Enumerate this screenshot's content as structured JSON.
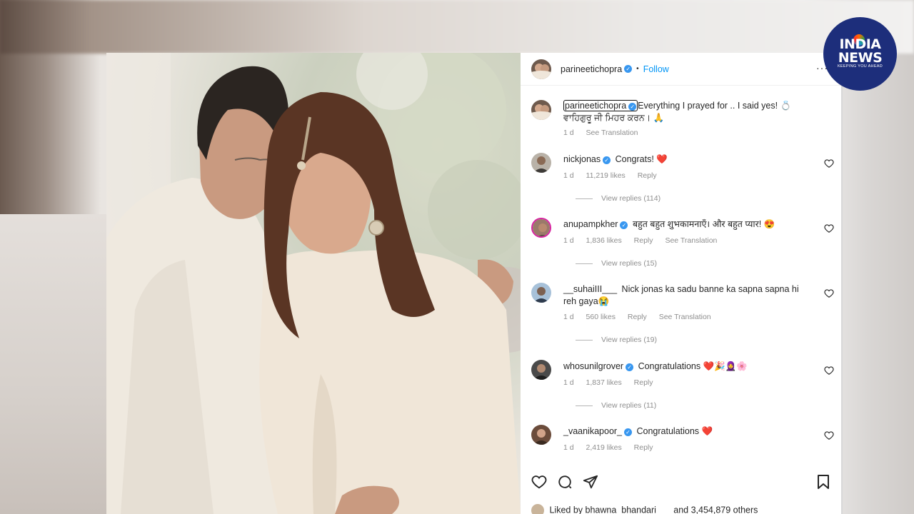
{
  "post": {
    "author": "parineetichopra",
    "follow_label": "Follow",
    "dot": "•",
    "more": "···",
    "caption_line1": "Everything I prayed for .. I said yes! 💍",
    "caption_line2": "ਵਾਹਿਗੁਰੂ ਜੀ ਮਿਹਰ ਕਰਨ। 🙏",
    "caption_time": "1 d",
    "caption_see_translation": "See Translation"
  },
  "comments": [
    {
      "user": "nickjonas",
      "verified": true,
      "text": "Congrats! ❤️",
      "time": "1 d",
      "likes": "11,219 likes",
      "reply": "Reply",
      "see_translation": "",
      "view_replies": "View replies (114)"
    },
    {
      "user": "anupampkher",
      "verified": true,
      "text": "बहुत बहुत शुभकामनाएँ। और बहुत प्यार! 😍",
      "time": "1 d",
      "likes": "1,836 likes",
      "reply": "Reply",
      "see_translation": "See Translation",
      "view_replies": "View replies (15)"
    },
    {
      "user": "__suhaiIII___",
      "verified": false,
      "text": "Nick jonas ka sadu banne ka sapna sapna hi reh gaya😭",
      "time": "1 d",
      "likes": "560 likes",
      "reply": "Reply",
      "see_translation": "See Translation",
      "view_replies": "View replies (19)"
    },
    {
      "user": "whosunilgrover",
      "verified": true,
      "text": "Congratulations ❤️🎉🧕🌸",
      "time": "1 d",
      "likes": "1,837 likes",
      "reply": "Reply",
      "see_translation": "",
      "view_replies": "View replies (11)"
    },
    {
      "user": "_vaanikapoor_",
      "verified": true,
      "text": "Congratulations ❤️",
      "time": "1 d",
      "likes": "2,419 likes",
      "reply": "Reply",
      "see_translation": "",
      "view_replies": ""
    }
  ],
  "likes_line": {
    "prefix": "Liked by",
    "user": "bhawna_bhandari___",
    "suffix": "and 3,454,879 others"
  },
  "logo": {
    "line1": "INDIA",
    "line2": "NEWS",
    "tagline": "KEEPING YOU AHEAD"
  },
  "colors": {
    "follow_blue": "#0095f6",
    "verified_blue": "#3897f0",
    "logo_navy": "#1d2e7b"
  }
}
